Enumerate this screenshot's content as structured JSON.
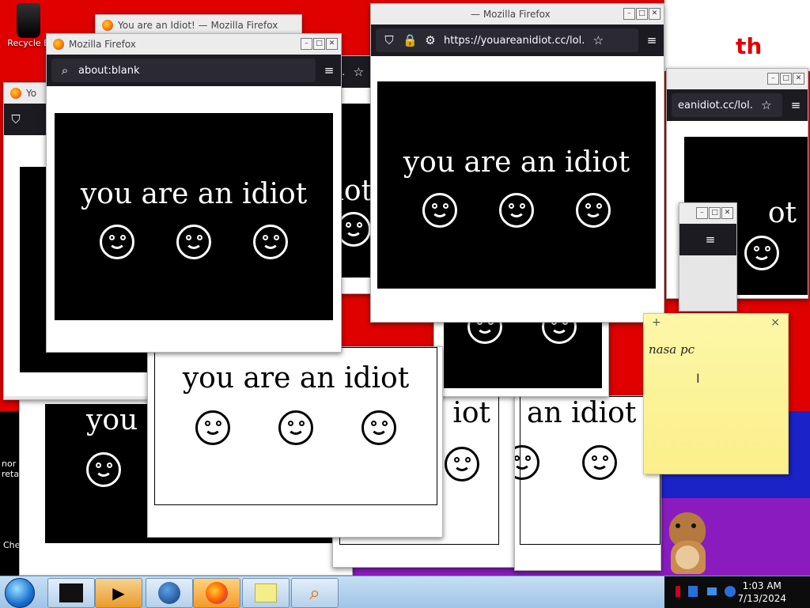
{
  "desktop": {
    "recycle_bin_label": "Recycle B",
    "icon_no": "nor",
    "icon_no2": "reta",
    "icon_ch": "Che",
    "corner_text": "th"
  },
  "windows": {
    "back_title": "You are an Idiot! — Mozilla Firefox",
    "main_title": "Mozilla Firefox",
    "main_url": "about:blank",
    "right_title": "— Mozilla Firefox",
    "right_url": "https://youareanidiot.cc/lol.",
    "far_url": "eanidiot.cc/lol.",
    "left_tab_text": "Yo",
    "mid_url_fragment": "lol."
  },
  "prank": {
    "text": "you are an idiot",
    "frag_iot": "iot",
    "frag_you_a": "you a",
    "frag_an_idiot": "an idiot",
    "frag_idiot": "idiot",
    "frag_ot": "ot"
  },
  "sticky_note": {
    "add_label": "+",
    "close_label": "×",
    "text": "nasa pc"
  },
  "taskbar": {
    "time": "1:03 AM",
    "date": "7/13/2024",
    "icons": [
      "terminal-icon",
      "media-player-icon",
      "globe-icon",
      "firefox-icon",
      "sticky-notes-icon",
      "search-icon"
    ]
  }
}
